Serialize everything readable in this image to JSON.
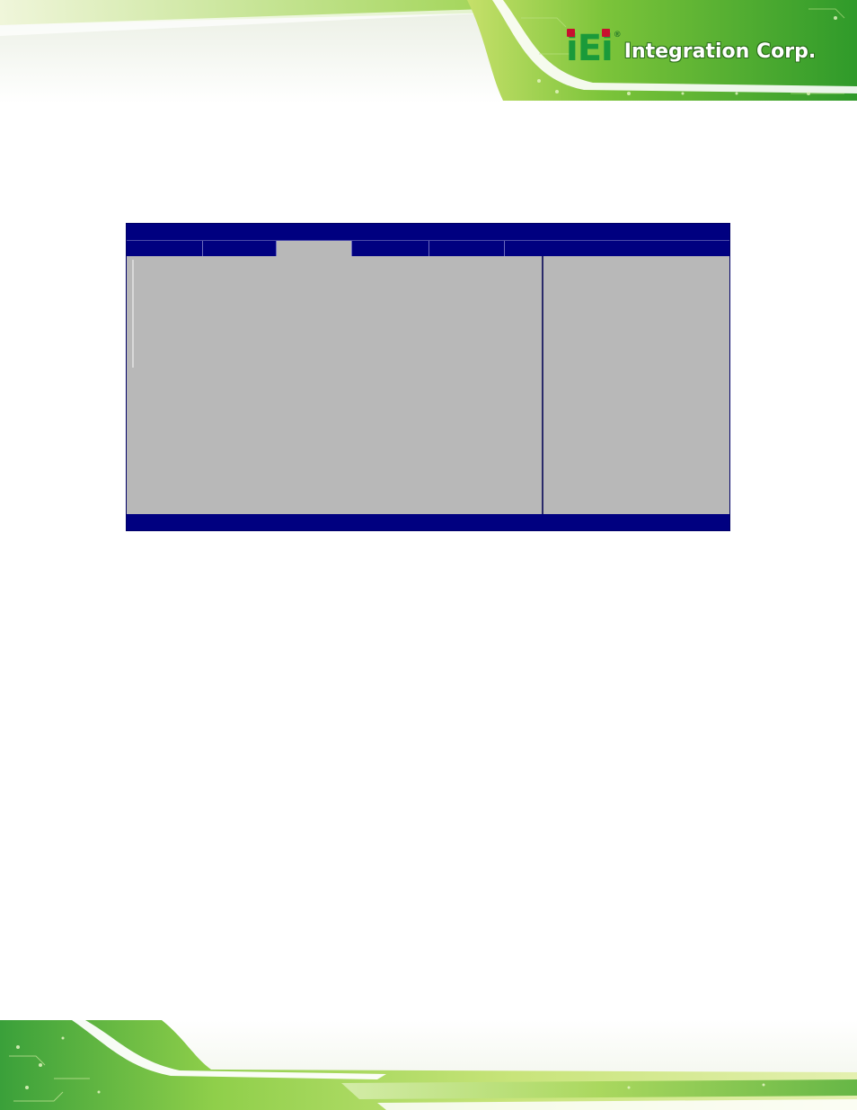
{
  "brand": {
    "mark_letters": [
      "i",
      "E",
      "i"
    ],
    "reg_symbol": "®",
    "company_name": "Integration Corp."
  },
  "colors": {
    "banner_green_light": "#cfe87a",
    "banner_green_dark": "#2f8f2a",
    "bios_blue": "#000080",
    "bios_gray": "#b8b8b8",
    "logo_red_dot": "#c8102e"
  },
  "bios": {
    "title": "",
    "tabs": [
      {
        "label": "",
        "active": false
      },
      {
        "label": "",
        "active": false
      },
      {
        "label": "",
        "active": true
      },
      {
        "label": "",
        "active": false
      },
      {
        "label": "",
        "active": false
      }
    ],
    "status_bar": ""
  }
}
